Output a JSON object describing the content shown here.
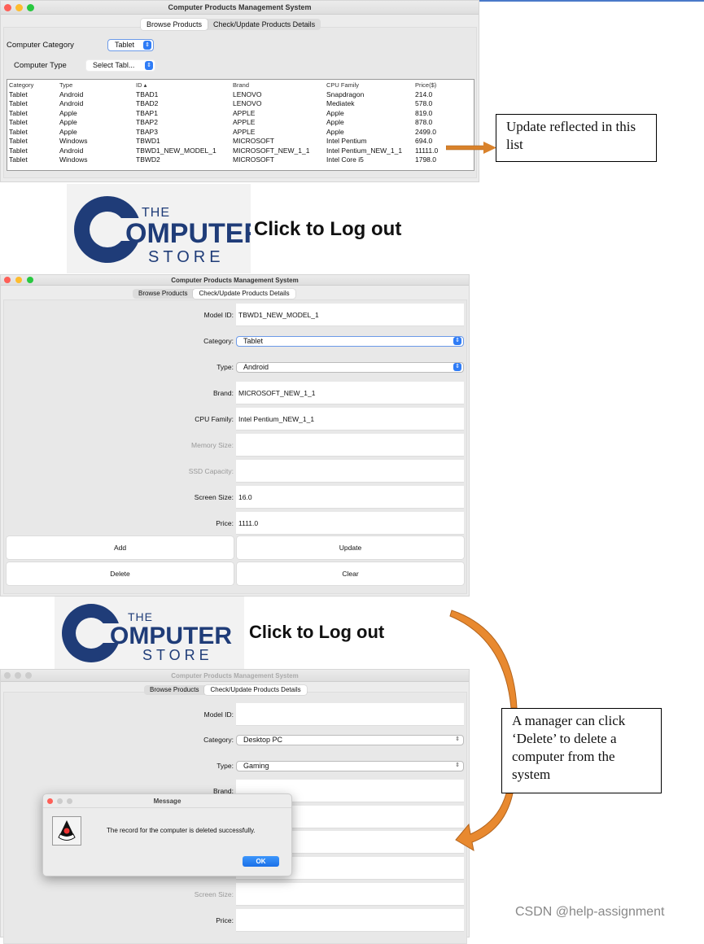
{
  "app_title": "Computer Products Management System",
  "tabs": [
    "Browse Products",
    "Check/Update Products Details"
  ],
  "browse": {
    "category_label": "Computer Category",
    "category_value": "Tablet",
    "type_label": "Computer Type",
    "type_value": "Select Tabl...",
    "columns": [
      "Category",
      "Type",
      "ID ▴",
      "Brand",
      "CPU Family",
      "Price($)"
    ],
    "rows": [
      [
        "Tablet",
        "Android",
        "TBAD1",
        "LENOVO",
        "Snapdragon",
        "214.0"
      ],
      [
        "Tablet",
        "Android",
        "TBAD2",
        "LENOVO",
        "Mediatek",
        "578.0"
      ],
      [
        "Tablet",
        "Apple",
        "TBAP1",
        "APPLE",
        "Apple",
        "819.0"
      ],
      [
        "Tablet",
        "Apple",
        "TBAP2",
        "APPLE",
        "Apple",
        "878.0"
      ],
      [
        "Tablet",
        "Apple",
        "TBAP3",
        "APPLE",
        "Apple",
        "2499.0"
      ],
      [
        "Tablet",
        "Windows",
        "TBWD1",
        "MICROSOFT",
        "Intel Pentium",
        "694.0"
      ],
      [
        "Tablet",
        "Android",
        "TBWD1_NEW_MODEL_1",
        "MICROSOFT_NEW_1_1",
        "Intel Pentium_NEW_1_1",
        "11111.0"
      ],
      [
        "Tablet",
        "Windows",
        "TBWD2",
        "MICROSOFT",
        "Intel Core i5",
        "1798.0"
      ]
    ]
  },
  "callout1": "Update reflected in this list",
  "logo": {
    "the": "THE",
    "c": "C",
    "omputer": "OMPUTER",
    "store": "STORE"
  },
  "logout_label": "Click to Log out",
  "form1": {
    "fields": [
      {
        "label": "Model ID:",
        "value": "TBWD1_NEW_MODEL_1",
        "type": "text"
      },
      {
        "label": "Category:",
        "value": "Tablet",
        "type": "combo"
      },
      {
        "label": "Type:",
        "value": "Android",
        "type": "combo"
      },
      {
        "label": "Brand:",
        "value": "MICROSOFT_NEW_1_1",
        "type": "text"
      },
      {
        "label": "CPU Family:",
        "value": "Intel Pentium_NEW_1_1",
        "type": "text"
      },
      {
        "label": "Memory Size:",
        "value": "",
        "type": "text",
        "disabled": true
      },
      {
        "label": "SSD Capacity:",
        "value": "",
        "type": "text",
        "disabled": true
      },
      {
        "label": "Screen Size:",
        "value": "16.0",
        "type": "text"
      },
      {
        "label": "Price:",
        "value": "1111.0",
        "type": "text"
      }
    ],
    "buttons": [
      "Add",
      "Update",
      "Delete",
      "Clear"
    ]
  },
  "form2": {
    "fields": [
      {
        "label": "Model ID:",
        "value": ""
      },
      {
        "label": "Category:",
        "value": "Desktop PC"
      },
      {
        "label": "Type:",
        "value": "Gaming"
      },
      {
        "label": "Brand:",
        "value": ""
      },
      {
        "label": "",
        "value": ""
      },
      {
        "label": "",
        "value": ""
      },
      {
        "label": "",
        "value": ""
      },
      {
        "label": "Screen Size:",
        "value": ""
      },
      {
        "label": "Price:",
        "value": ""
      }
    ]
  },
  "dialog": {
    "title": "Message",
    "message": "The record for the computer is deleted successfully.",
    "ok": "OK"
  },
  "callout2": "A manager can click ‘Delete’ to delete a computer from the system",
  "watermark": "CSDN @help-assignment",
  "colors": {
    "accent": "#2f7cf6",
    "arrow": "#d9822b",
    "logo_blue": "#1f3c78"
  }
}
